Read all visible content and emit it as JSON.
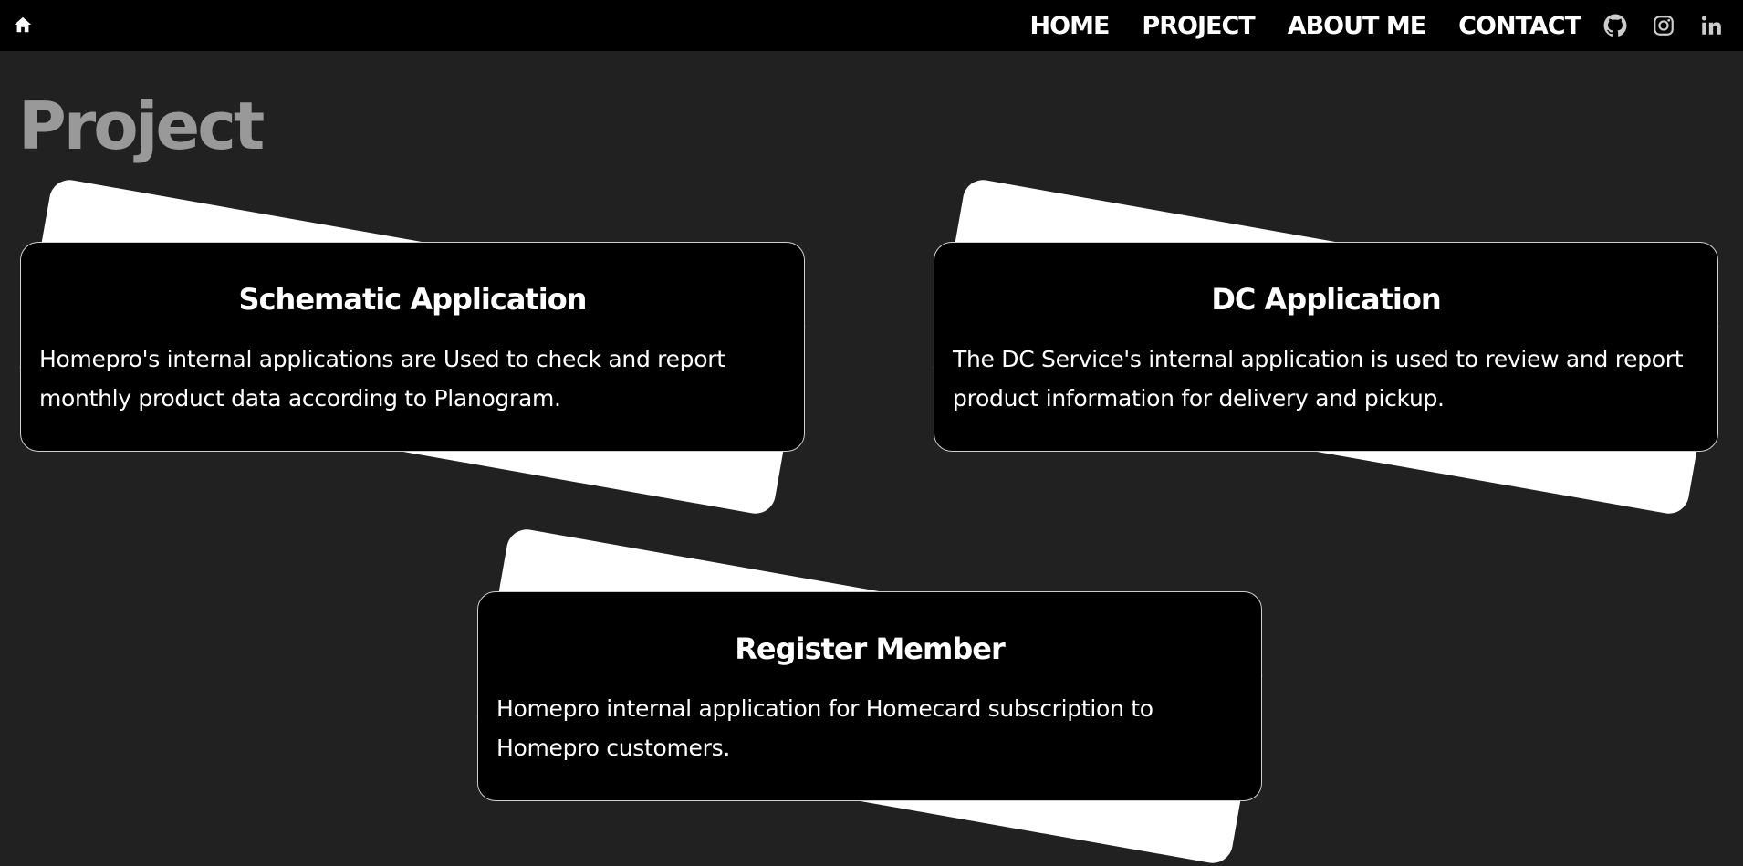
{
  "nav": {
    "home_icon": "home-icon",
    "links": [
      "HOME",
      "PROJECT",
      "ABOUT ME",
      "CONTACT"
    ],
    "social_icons": [
      "github-icon",
      "instagram-icon",
      "linkedin-icon"
    ]
  },
  "page": {
    "title": "Project"
  },
  "projects": [
    {
      "title": "Schematic Application",
      "description": "Homepro's internal applications are Used to check and report monthly product data according to Planogram."
    },
    {
      "title": "DC Application",
      "description": "The DC Service's internal application is used to review and report product information for delivery and pickup."
    },
    {
      "title": "Register Member",
      "description": "Homepro internal application for Homecard subscription to Homepro customers."
    }
  ],
  "colors": {
    "background": "#212121",
    "navbar": "#000000",
    "title": "#999999",
    "card": "#000000",
    "card_back": "#ffffff",
    "text": "#ffffff"
  }
}
